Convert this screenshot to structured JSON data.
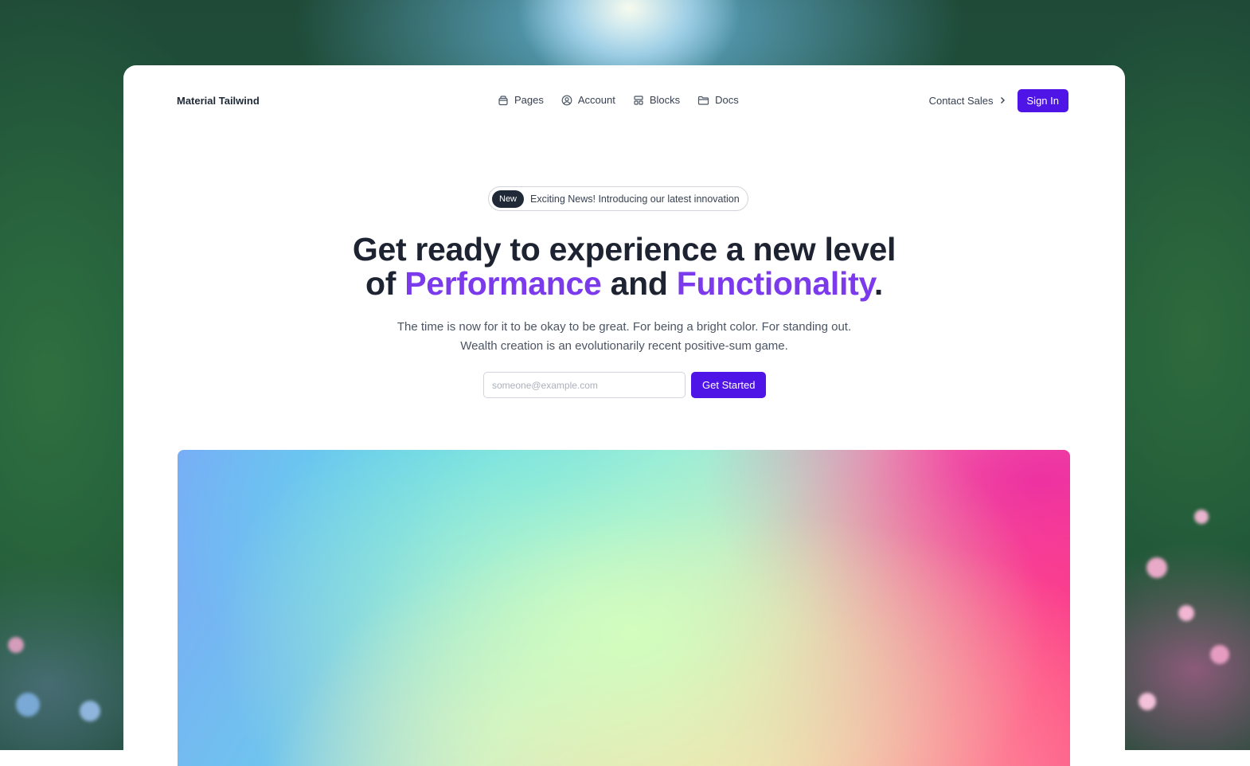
{
  "brand": "Material Tailwind",
  "nav": {
    "links": [
      {
        "label": "Pages",
        "icon": "box-icon"
      },
      {
        "label": "Account",
        "icon": "user-circle-icon"
      },
      {
        "label": "Blocks",
        "icon": "blocks-icon"
      },
      {
        "label": "Docs",
        "icon": "folder-icon"
      }
    ],
    "contact_label": "Contact Sales",
    "signin_label": "Sign In"
  },
  "hero": {
    "badge_pill": "New",
    "badge_text": "Exciting News! Introducing our latest innovation",
    "headline_start": "Get ready to experience a new level",
    "headline_of": "of ",
    "headline_accent1": "Performance",
    "headline_and": " and ",
    "headline_accent2": "Functionality",
    "headline_end": ".",
    "subtext_line1": "The time is now for it to be okay to be great. For being a bright color. For standing out.",
    "subtext_line2": "Wealth creation is an evolutionarily recent positive-sum game.",
    "email_placeholder": "someone@example.com",
    "cta_label": "Get Started"
  },
  "colors": {
    "primary": "#4f14e6",
    "accent_text": "#7c3aed",
    "heading": "#1e2332"
  }
}
